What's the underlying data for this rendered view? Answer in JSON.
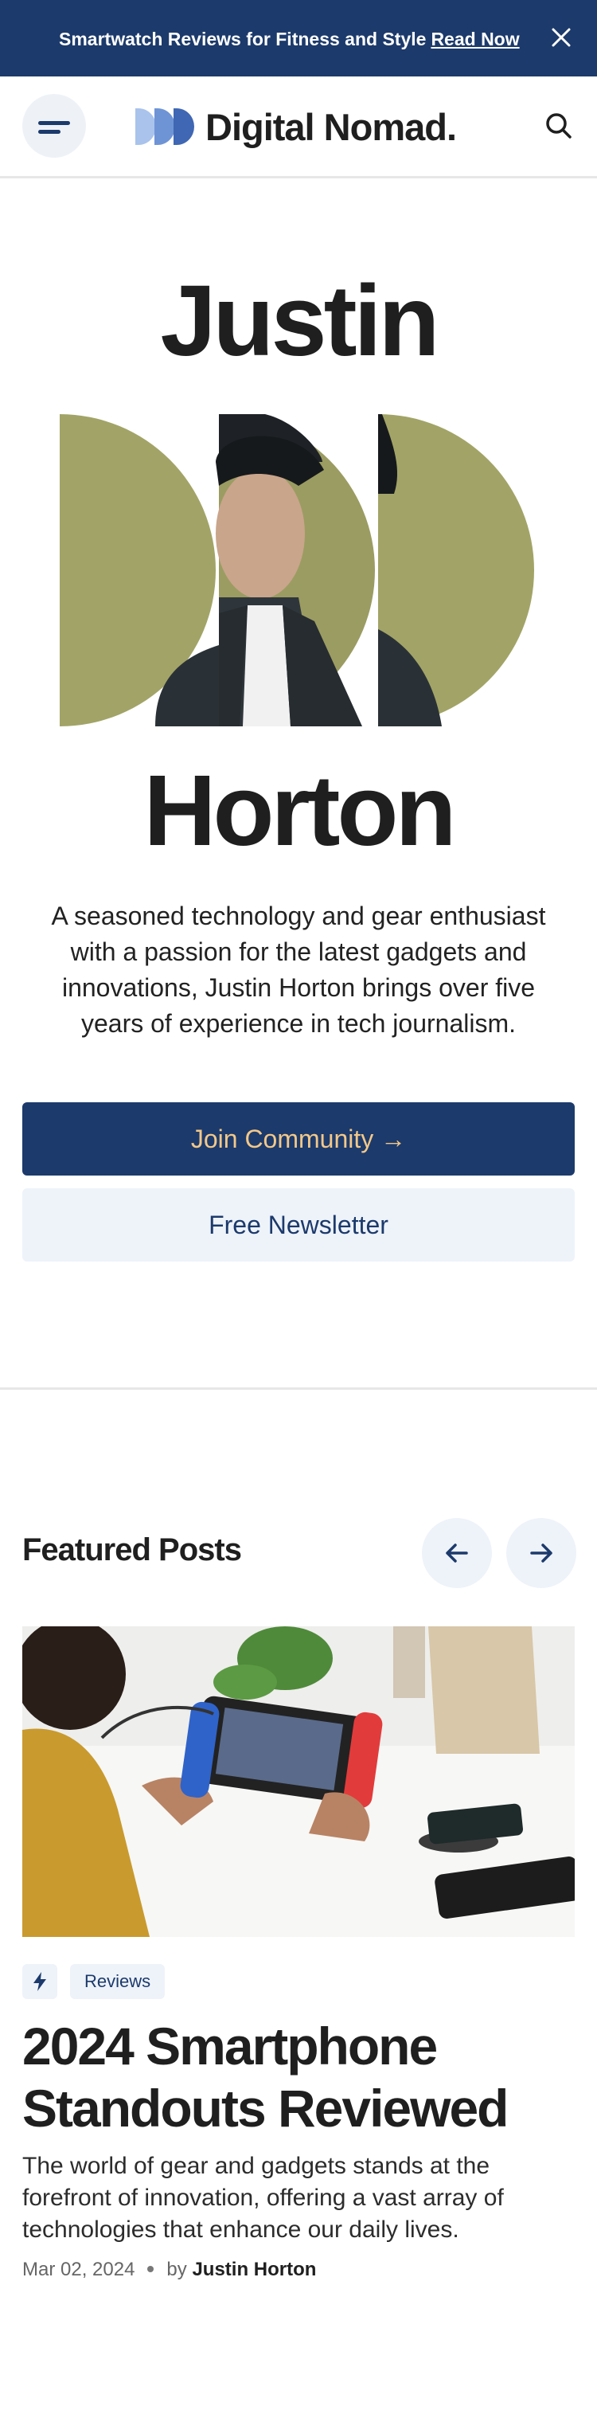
{
  "banner": {
    "text": "Smartwatch Reviews for Fitness and Style",
    "link": "Read Now"
  },
  "header": {
    "logo_text": "Digital Nomad.",
    "icons": [
      "menu-icon",
      "search-icon"
    ]
  },
  "hero": {
    "first_name": "Justin",
    "last_name": "Horton",
    "bio": "A seasoned technology and gear enthusiast with a passion for the latest gadgets and innovations, Justin Horton brings over five years of experience in tech journalism.",
    "join_label": "Join Community",
    "join_arrow": "→",
    "newsletter_label": "Free Newsletter"
  },
  "featured": {
    "title": "Featured Posts",
    "prev_icon": "arrow-left-icon",
    "next_icon": "arrow-right-icon"
  },
  "post": {
    "category": "Reviews",
    "title": "2024 Smartphone Standouts Reviewed",
    "excerpt": "The world of gear and gadgets stands at the forefront of innovation, offering a vast array of technologies that enhance our daily lives.",
    "date": "Mar 02, 2024",
    "by": "by",
    "author": "Justin Horton"
  },
  "colors": {
    "navy": "#1c3a6b",
    "gold": "#f2c88a",
    "light_bg": "#eef3fa",
    "olive": "#a2a467"
  }
}
